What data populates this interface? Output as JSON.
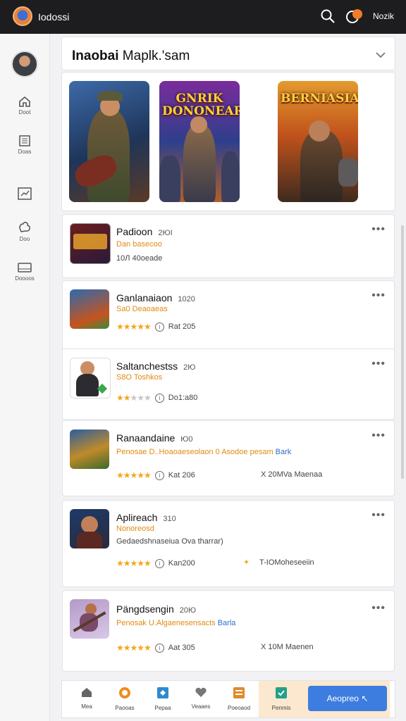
{
  "header": {
    "app_title": "Iodossi",
    "user_label": "Nozik"
  },
  "sidebar": {
    "items": [
      {
        "label": "Doot",
        "icon": "home-icon"
      },
      {
        "label": "Doas",
        "icon": "list-icon"
      },
      {
        "label": "",
        "icon": "chart-icon"
      },
      {
        "label": "Doo",
        "icon": "puzzle-icon"
      },
      {
        "label": "Doooos",
        "icon": "card-icon"
      }
    ]
  },
  "section": {
    "title_bold": "Inaobai",
    "title_rest": " Maplk.'sam"
  },
  "banners": [
    {
      "text": "",
      "theme": "#2c4a7a"
    },
    {
      "text": "GNRIK DONONEAR",
      "theme": "#6a2f8a"
    },
    {
      "text": "BERNIASIA",
      "theme": "#b4541a"
    }
  ],
  "games": [
    {
      "title": "Padioon",
      "year": "2ЮI",
      "sub": "Dan basecoo",
      "sub_blue": "",
      "meta_left": "10Л  40oeade",
      "stars": 0,
      "info": "",
      "right": ""
    },
    {
      "title": "Ganlanaiaon",
      "year": "1020",
      "sub": "Sa0  Deaoaeas",
      "sub_blue": "",
      "meta_left": "",
      "stars": 5,
      "info": "Rat 205",
      "right": ""
    },
    {
      "title": "Saltanchestss",
      "year": "2Ю",
      "sub": "S8O  Toshkos",
      "sub_blue": "",
      "meta_left": "",
      "stars": 2,
      "info": "Do1:a80",
      "right": ""
    },
    {
      "title": "Ranaandaine",
      "year": "Ю0",
      "sub": "Penosae  D..Hoaoaeseolaon 0  Asodoe pesam",
      "sub_blue": "Bark",
      "meta_left": "",
      "stars": 5,
      "info": "Kat 206",
      "right": "X 20MVa Maenaa"
    },
    {
      "title": "Aplireach",
      "year": "310",
      "sub": "Nonoreosd",
      "sub_blue": "",
      "meta_left": "Gedaedshnaseiua Ova tharrar)",
      "stars": 5,
      "info": "Kan200",
      "right": "T-IOMoheseeiin"
    },
    {
      "title": "Pängdsengin",
      "year": "20Ю",
      "sub": "Penosak  U.Algaenesensacts",
      "sub_blue": "Barla",
      "meta_left": "",
      "stars": 5,
      "info": "Aat 305",
      "right": "X 10M Maenen"
    }
  ],
  "bottom_nav": {
    "items": [
      "Mea",
      "Paooas",
      "Pepaa",
      "Veaaes",
      "Poeoaod",
      "Penmis"
    ],
    "action_label": "Aeopreo"
  },
  "colors": {
    "accent": "#3d7de0",
    "star": "#f2a71b",
    "orange_text": "#e08a12",
    "topbar": "#1d1d1f"
  }
}
